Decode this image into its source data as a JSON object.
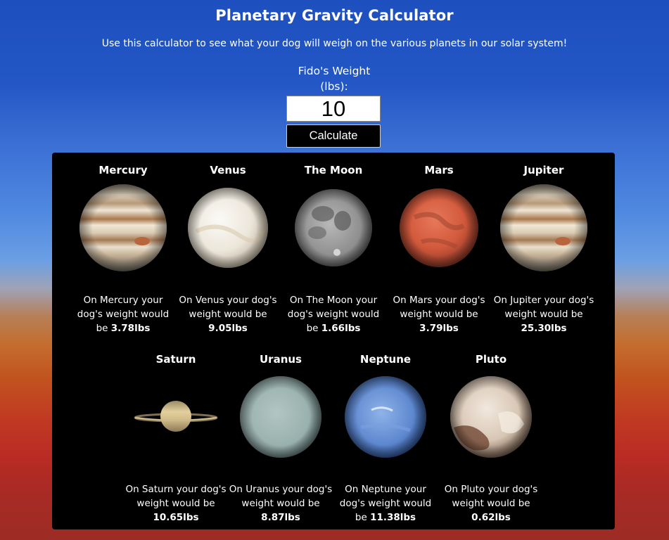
{
  "header": {
    "title": "Planetary Gravity Calculator",
    "subtitle": "Use this calculator to see what your dog will weigh on the various planets in our solar system!"
  },
  "form": {
    "label_line1": "Fido's Weight",
    "label_line2": "(lbs):",
    "weight_value": "10",
    "button_label": "Calculate"
  },
  "planets": [
    {
      "name": "Mercury",
      "text": "On Mercury your dog's weight would be",
      "weight": "3.78lbs",
      "icon": "jupiter-image"
    },
    {
      "name": "Venus",
      "text": "On Venus your dog's weight would be",
      "weight": "9.05lbs",
      "icon": "venus-image"
    },
    {
      "name": "The Moon",
      "text": "On The Moon your dog's weight would be",
      "weight": "1.66lbs",
      "icon": "moon-image"
    },
    {
      "name": "Mars",
      "text": "On Mars your dog's weight would be",
      "weight": "3.79lbs",
      "icon": "mars-image"
    },
    {
      "name": "Jupiter",
      "text": "On Jupiter your dog's weight would be",
      "weight": "25.30lbs",
      "icon": "jupiter-image"
    },
    {
      "name": "Saturn",
      "text": "On Saturn your dog's weight would be",
      "weight": "10.65lbs",
      "icon": "saturn-image"
    },
    {
      "name": "Uranus",
      "text": "On Uranus your dog's weight would be",
      "weight": "8.87lbs",
      "icon": "uranus-image"
    },
    {
      "name": "Neptune",
      "text": "On Neptune your dog's weight would be",
      "weight": "11.38lbs",
      "icon": "neptune-image"
    },
    {
      "name": "Pluto",
      "text": "On Pluto your dog's weight would be",
      "weight": "0.62lbs",
      "icon": "pluto-image"
    }
  ]
}
